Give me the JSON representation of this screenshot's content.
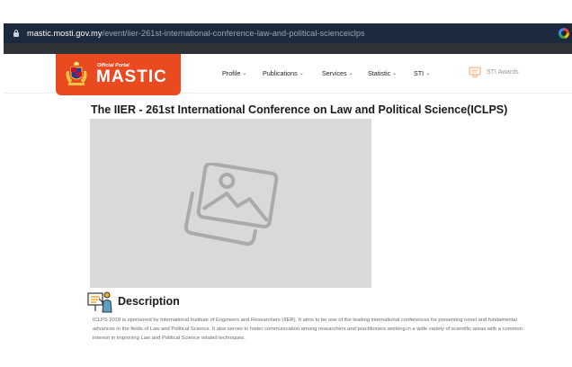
{
  "browser": {
    "url_host": "mastic.mosti.gov.my",
    "url_path": "/event/iier-261st-international-conference-law-and-political-scienceiclps"
  },
  "header": {
    "logo_small": "Official Portal",
    "logo_big": "MASTIC",
    "nav": [
      "Profile",
      "Publications",
      "Services",
      "Statistic",
      "STI"
    ],
    "sti_awards": "STI Awards"
  },
  "event": {
    "title": "The IIER - 261st International Conference on Law and Political Science(ICLPS)",
    "description_heading": "Description",
    "description": "ICLPS 2018 is sponsored by International Institute of Engineers and Researchers (IIER). It aims to be one of the leading international conferences for presenting novel and fundamental advances in the fields of Law and Political Science. It also serves to foster communication among researchers and practitioners working in a wide variety of scientific areas with a common interest in improving Law and Political Science related techniques."
  },
  "colors": {
    "logo_bg": "#ea4a1f",
    "address_bar": "#1b2a3d",
    "placeholder_bg": "#d9d9d9"
  }
}
